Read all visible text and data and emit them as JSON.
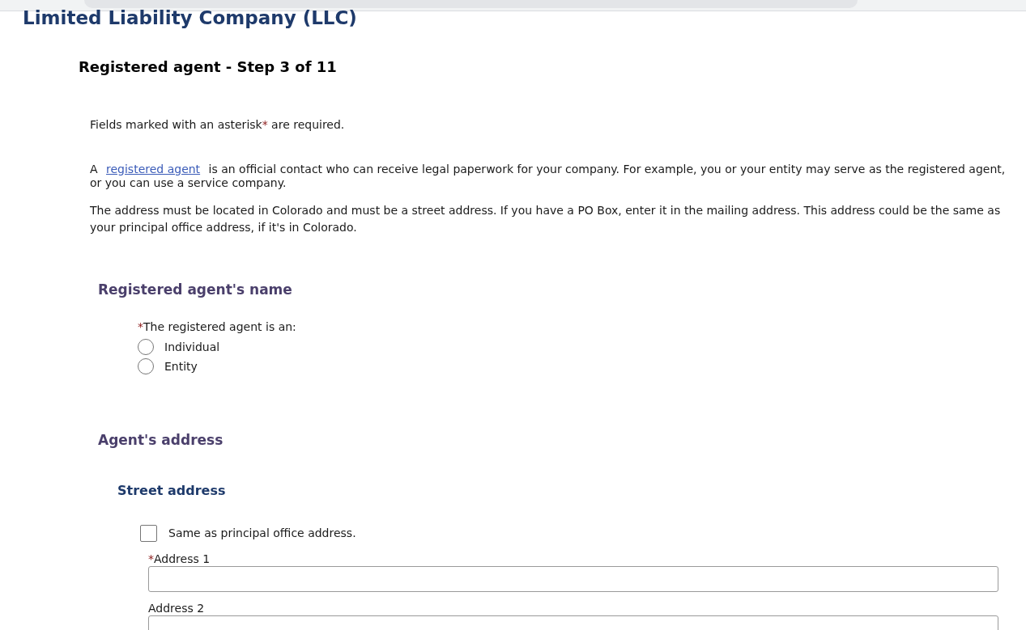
{
  "page_title": "Limited Liability Company (LLC)",
  "step_title": "Registered agent - Step 3 of 11",
  "required_note": {
    "before": "Fields marked with an asterisk",
    "mark": "*",
    "after": " are required."
  },
  "agent_intro": {
    "before": "A",
    "link": "registered agent",
    "after": "is an official contact who can receive legal paperwork for your company. For example, you or your entity may serve as the registered agent, or you can use a service company."
  },
  "address_note": "The address must be located in Colorado and must be a street address. If you have a PO Box, enter it in the mailing address. This address could be the same as your principal office address, if it's in Colorado.",
  "name_section": {
    "title": "Registered agent's name",
    "question": {
      "mark": "*",
      "label": "The registered agent is an:"
    },
    "options": [
      {
        "label": "Individual",
        "selected": false
      },
      {
        "label": "Entity",
        "selected": false
      }
    ]
  },
  "address_section": {
    "title": "Agent's address",
    "subtitle": "Street address",
    "same_as_principal": {
      "label": "Same as principal office address.",
      "checked": false
    },
    "fields": [
      {
        "mark": "*",
        "label": "Address 1"
      },
      {
        "label": "Address 2"
      }
    ]
  }
}
